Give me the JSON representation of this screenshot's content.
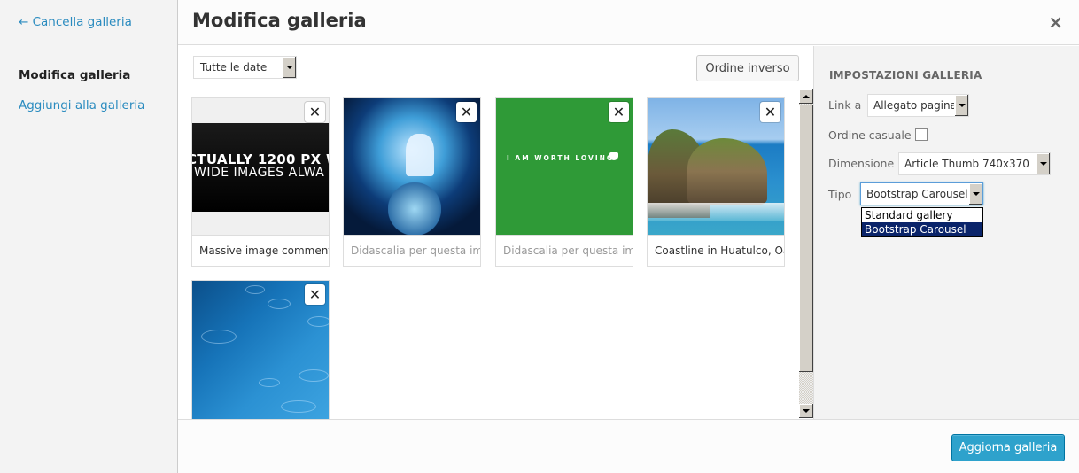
{
  "menu": {
    "cancel_label": "← Cancella galleria",
    "items": [
      {
        "label": "Modifica galleria",
        "active": true
      },
      {
        "label": "Aggiungi alla galleria",
        "active": false
      }
    ]
  },
  "header": {
    "title": "Modifica galleria",
    "close_icon": "×"
  },
  "toolbar": {
    "date_filter": "Tutte le date",
    "reverse_label": "Ordine inverso"
  },
  "gallery": {
    "remove_icon": "✕",
    "items": [
      {
        "image": "massive-image",
        "image_text_1": "CTUALLY 1200 PX W",
        "image_text_2": "WIDE IMAGES ALWA",
        "caption": "Massive image comment",
        "caption_is_placeholder": false
      },
      {
        "image": "unicorn",
        "caption": "Didascalia per questa im",
        "caption_is_placeholder": true
      },
      {
        "image": "green-quote",
        "image_text_1": "I AM WORTH LOVING",
        "caption": "Didascalia per questa im",
        "caption_is_placeholder": true
      },
      {
        "image": "coastline",
        "caption": "Coastline in Huatulco, Oa",
        "caption_is_placeholder": false
      },
      {
        "image": "rain-water"
      }
    ]
  },
  "settings": {
    "heading": "Impostazioni galleria",
    "link_label": "Link a",
    "link_value": "Allegato pagina",
    "random_label": "Ordine casuale",
    "random_checked": false,
    "size_label": "Dimensione",
    "size_value": "Article Thumb 740x370",
    "type_label": "Tipo",
    "type_value": "Bootstrap Carousel",
    "type_options": [
      "Standard gallery",
      "Bootstrap Carousel"
    ],
    "type_selected_index": 1
  },
  "footer": {
    "update_label": "Aggiorna galleria"
  },
  "colors": {
    "link": "#2a8bbf",
    "primary_button": "#2ea2cc",
    "dropdown_selected": "#0a246a"
  }
}
